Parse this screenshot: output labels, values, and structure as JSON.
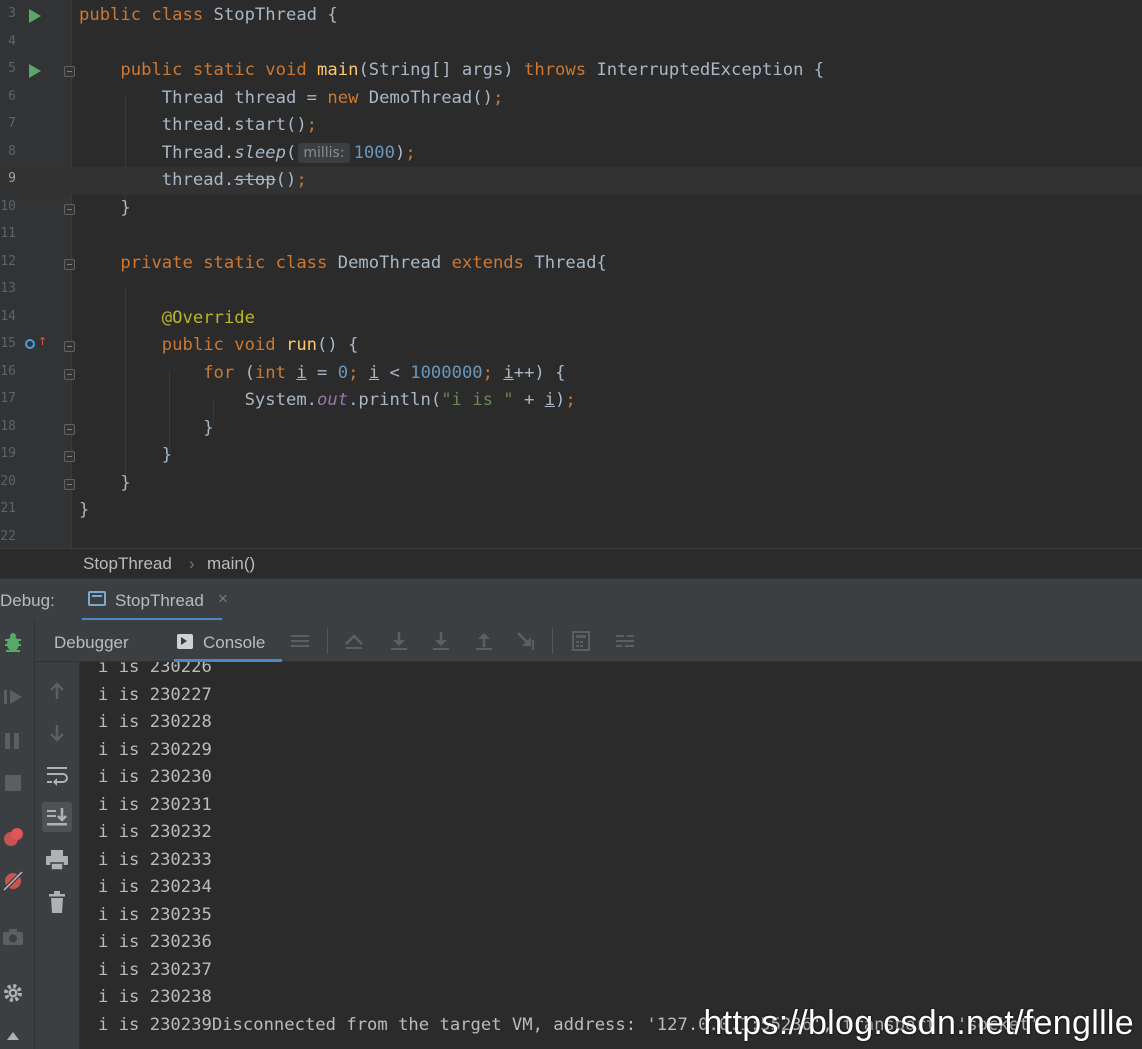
{
  "editor": {
    "lines": [
      {
        "n": "3",
        "run": true,
        "fold": false
      },
      {
        "n": "4"
      },
      {
        "n": "5",
        "run": true,
        "fold": true
      },
      {
        "n": "6"
      },
      {
        "n": "7"
      },
      {
        "n": "8"
      },
      {
        "n": "9",
        "current": true
      },
      {
        "n": "10",
        "fold": true
      },
      {
        "n": "11"
      },
      {
        "n": "12",
        "fold": true
      },
      {
        "n": "13"
      },
      {
        "n": "14"
      },
      {
        "n": "15",
        "override": true,
        "fold": true
      },
      {
        "n": "16",
        "fold": true
      },
      {
        "n": "17"
      },
      {
        "n": "18",
        "fold": true
      },
      {
        "n": "19",
        "fold": true
      },
      {
        "n": "20",
        "fold": true
      },
      {
        "n": "21"
      },
      {
        "n": "22"
      }
    ],
    "code": {
      "l3": {
        "kw1": "public class",
        "name": " StopThread {"
      },
      "l5": {
        "kw1": "public static void",
        "fn": "main",
        "params": "(String[] args) ",
        "kw2": "throws",
        "rest": " InterruptedException {"
      },
      "l6": {
        "a": "Thread thread = ",
        "kw": "new",
        "b": " DemoThread()",
        "semi": ";"
      },
      "l7": {
        "a": "thread.start()",
        "semi": ";"
      },
      "l8": {
        "a": "Thread.",
        "method": "sleep",
        "open": "(",
        "hint": "millis:",
        "num": "1000",
        "close": ")",
        "semi": ";"
      },
      "l9": {
        "a": "thread.",
        "method": "stop",
        "close": "()",
        "semi": ";"
      },
      "l10": {
        "a": "}"
      },
      "l12": {
        "kw1": "private static class",
        "name": " DemoThread ",
        "kw2": "extends",
        "rest": " Thread{"
      },
      "l14": {
        "ann": "@Override"
      },
      "l15": {
        "kw1": "public void",
        "fn": "run",
        "rest": "() {"
      },
      "l16": {
        "kw1": "for",
        "p1": " (",
        "kw2": "int",
        "sp": " ",
        "v1": "i",
        "eq": " = ",
        "n0": "0",
        "s1": "; ",
        "v2": "i",
        "lt": " < ",
        "n1": "1000000",
        "s2": "; ",
        "v3": "i",
        "inc": "++) {"
      },
      "l17": {
        "a": "System.",
        "field": "out",
        "b": ".println(",
        "str": "\"i is \"",
        "plus": " + ",
        "v": "i",
        "close": ")",
        "semi": ";"
      },
      "l18": {
        "a": "}"
      },
      "l19": {
        "a": "}"
      },
      "l20": {
        "a": "}"
      },
      "l21": {
        "a": "}"
      }
    }
  },
  "breadcrumb": {
    "class_name": "StopThread",
    "separator": "›",
    "method": "main()"
  },
  "debug": {
    "title": "Debug:",
    "session_tab": "StopThread",
    "close_glyph": "×",
    "subtabs": {
      "debugger": "Debugger",
      "console": "Console"
    }
  },
  "console": {
    "lines": [
      "i is 230226",
      "i is 230227",
      "i is 230228",
      "i is 230229",
      "i is 230230",
      "i is 230231",
      "i is 230232",
      "i is 230233",
      "i is 230234",
      "i is 230235",
      "i is 230236",
      "i is 230237",
      "i is 230238",
      "i is 230239Disconnected from the target VM, address: '127.0.0.1:55236', transport: 'socket'"
    ]
  },
  "watermark": "https://blog.csdn.net/fengllle",
  "colors": {
    "keyword": "#cc7832",
    "function": "#ffc66d",
    "number": "#6897bb",
    "string": "#6a8759",
    "annotation": "#bbb529",
    "run_icon": "#59a869",
    "accent": "#4a88c7"
  }
}
